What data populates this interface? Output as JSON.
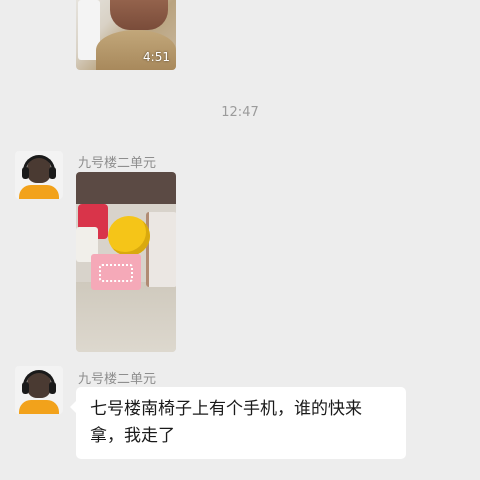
{
  "chat": {
    "video_message": {
      "duration": "4:51",
      "play_icon": "video-thumbnail"
    },
    "timestamp": "12:47",
    "messages": [
      {
        "sender": "九号楼二单元",
        "type": "photo"
      },
      {
        "sender": "九号楼二单元",
        "type": "text",
        "text": "七号楼南椅子上有个手机，谁的快来拿，我走了"
      }
    ]
  },
  "colors": {
    "background": "#ededed",
    "bubble": "#ffffff",
    "timestamp_text": "#9b9b9b",
    "sender_text": "#8e8e8e"
  }
}
